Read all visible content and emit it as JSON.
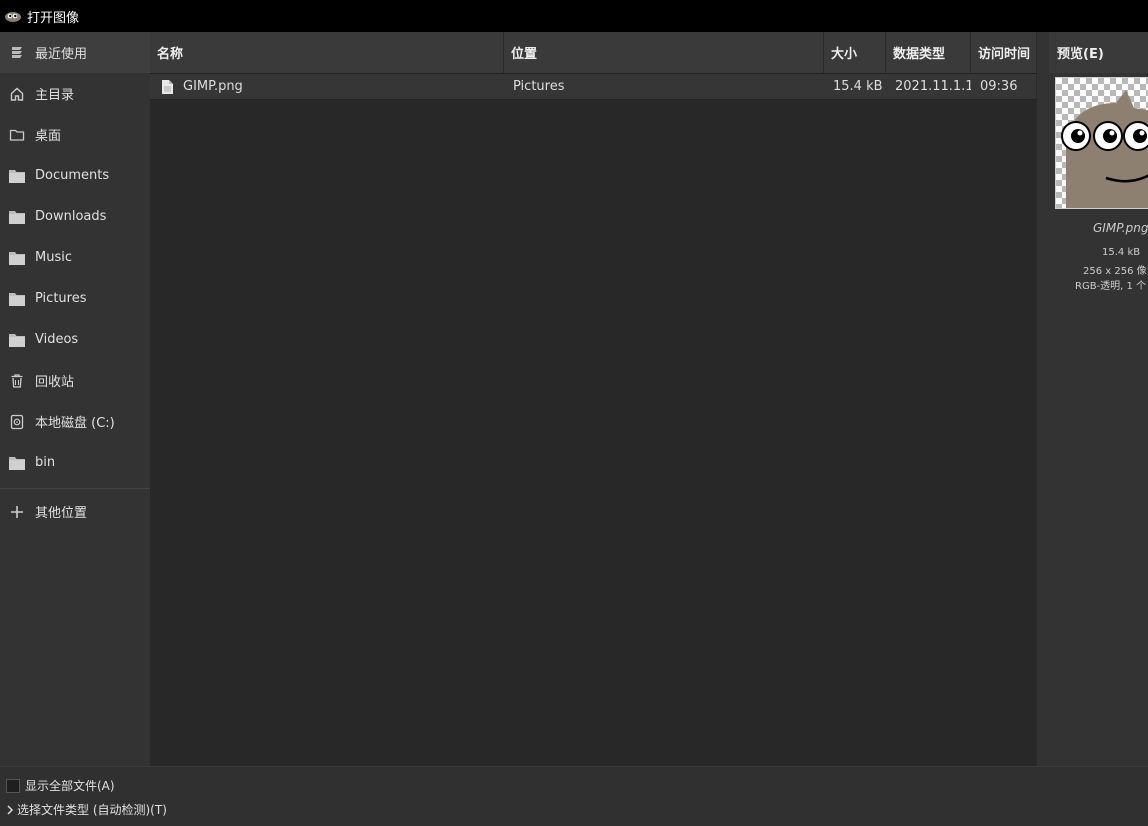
{
  "window": {
    "title": "打开图像"
  },
  "sidebar": {
    "items": [
      {
        "label": "最近使用",
        "icon": "recent-icon"
      },
      {
        "label": "主目录",
        "icon": "home-icon"
      },
      {
        "label": "桌面",
        "icon": "desktop-folder-icon"
      },
      {
        "label": "Documents",
        "icon": "folder-icon"
      },
      {
        "label": "Downloads",
        "icon": "folder-icon"
      },
      {
        "label": "Music",
        "icon": "folder-icon"
      },
      {
        "label": "Pictures",
        "icon": "folder-icon"
      },
      {
        "label": "Videos",
        "icon": "folder-icon"
      },
      {
        "label": "回收站",
        "icon": "trash-icon"
      },
      {
        "label": "本地磁盘 (C:)",
        "icon": "drive-icon"
      },
      {
        "label": "bin",
        "icon": "folder-icon"
      }
    ],
    "other": {
      "label": "其他位置",
      "icon": "plus-icon"
    }
  },
  "filelist": {
    "columns": [
      "名称",
      "位置",
      "大小",
      "数据类型",
      "访问时间"
    ],
    "rows": [
      {
        "name": "GIMP.png",
        "location": "Pictures",
        "size": "15.4 kB",
        "type": "2021.11.1.1",
        "accessed": "09:36"
      }
    ]
  },
  "preview": {
    "header": "预览(E)",
    "filename": "GIMP.png",
    "size": "15.4 kB",
    "dimensions": "256 x 256 像",
    "mode": "RGB-透明, 1 个"
  },
  "footer": {
    "show_all_label": "显示全部文件(A)",
    "file_type_label": "选择文件类型 (自动检测)(T)"
  }
}
